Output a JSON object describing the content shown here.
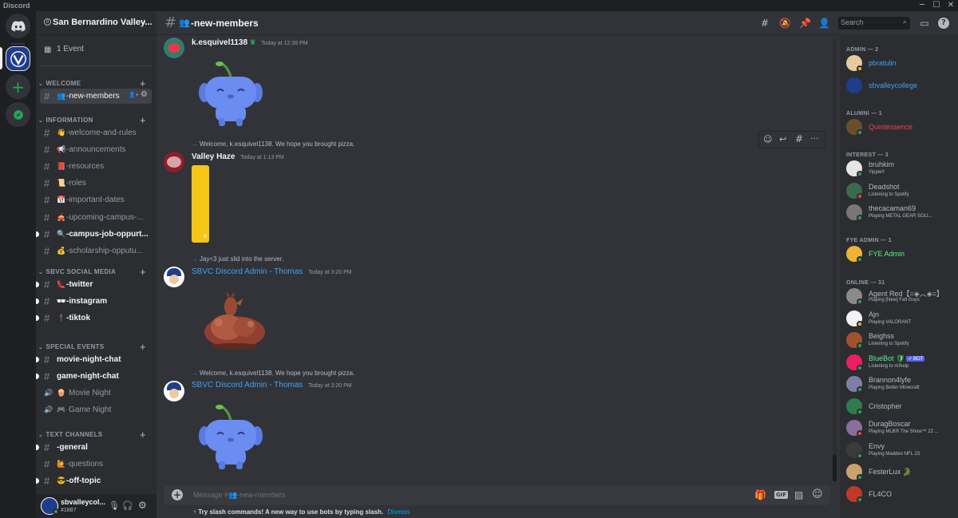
{
  "window": {
    "title": "Discord"
  },
  "guild_rail": {
    "items": [
      "discord-home",
      "sbvc-server",
      "add-server",
      "explore"
    ]
  },
  "server": {
    "name": "San Bernardino Valley...",
    "events_label": "1 Event",
    "categories": [
      {
        "label": "WELCOME",
        "channels": [
          {
            "emoji": "👥",
            "name": "-new-members",
            "state": "active"
          }
        ]
      },
      {
        "label": "INFORMATION",
        "channels": [
          {
            "emoji": "👋",
            "name": "-welcome-and-rules",
            "state": "normal"
          },
          {
            "emoji": "📢",
            "name": "-announcements",
            "state": "normal"
          },
          {
            "emoji": "📕",
            "name": "-resources",
            "state": "normal"
          },
          {
            "emoji": "📜",
            "name": "-roles",
            "state": "normal"
          },
          {
            "emoji": "📅",
            "name": "-important-dates",
            "state": "normal"
          },
          {
            "emoji": "🎪",
            "name": "-upcoming-campus-...",
            "state": "normal"
          },
          {
            "emoji": "🔍",
            "name": "-campus-job-oppurt...",
            "state": "unread"
          },
          {
            "emoji": "💰",
            "name": "-scholarship-opputu...",
            "state": "normal"
          }
        ]
      },
      {
        "label": "SBVC SOCIAL MEDIA",
        "channels": [
          {
            "emoji": "👠",
            "name": "-twitter",
            "state": "unread"
          },
          {
            "emoji": "🕶",
            "name": "-instagram",
            "state": "unread"
          },
          {
            "emoji": "🕴",
            "name": "-tiktok",
            "state": "unread"
          }
        ]
      },
      {
        "label": "SPECIAL EVENTS",
        "channels": [
          {
            "emoji": "",
            "name": "movie-night-chat",
            "state": "unread"
          },
          {
            "emoji": "",
            "name": "game-night-chat",
            "state": "unread"
          },
          {
            "emoji": "🍿",
            "name": "Movie Night",
            "state": "voice"
          },
          {
            "emoji": "🎮",
            "name": "Game Night",
            "state": "voice"
          }
        ]
      },
      {
        "label": "TEXT CHANNELS",
        "channels": [
          {
            "emoji": "",
            "name": "-general",
            "state": "unread"
          },
          {
            "emoji": "🙋",
            "name": "-questions",
            "state": "normal"
          },
          {
            "emoji": "😎",
            "name": "-off-topic",
            "state": "unread"
          }
        ]
      }
    ]
  },
  "user_panel": {
    "username": "sbvalleycol...",
    "tag": "#1887"
  },
  "channel_header": {
    "name": "-new-members",
    "search_placeholder": "Search"
  },
  "messages": [
    {
      "type": "message",
      "author": "k.esquivel1138",
      "author_color": "#f2f3f5",
      "time": "Today at 12:39 PM",
      "attachment": "wumpus-sticker"
    },
    {
      "type": "reply",
      "system_text": "Welcome, k.esquivel1138. We hope you brought pizza.",
      "author": "Valley Haze",
      "author_color": "#f2f3f5",
      "time": "Today at 1:13 PM",
      "attachment": "yellow-image"
    },
    {
      "type": "reply",
      "system_text": "Jay<3 just slid into the server.",
      "author": "SBVC Discord Admin - Thomas",
      "author_color": "#3fa2f5",
      "time": "Today at 3:20 PM",
      "attachment": "chicken-sticker"
    },
    {
      "type": "reply",
      "system_text": "Welcome, k.esquivel1138. We hope you brought pizza.",
      "author": "SBVC Discord Admin - Thomas",
      "author_color": "#3fa2f5",
      "time": "Today at 3:20 PM",
      "attachment": "wumpus-sticker"
    }
  ],
  "composer": {
    "placeholder": "Message #👥-new-members",
    "tip": "Try slash commands! A new way to use bots by typing slash.",
    "dismiss": "Dismiss"
  },
  "member_list": [
    {
      "group": "ADMIN — 2",
      "members": [
        {
          "name": "pbratulin",
          "status_text": "",
          "name_color": "#3fa2f5",
          "avatar_color": "#e8c9a0",
          "presence": "idle"
        },
        {
          "name": "sbvalleycollege",
          "status_text": "",
          "name_color": "#3fa2f5",
          "avatar_color": "#1f3d8a",
          "presence": "none"
        }
      ]
    },
    {
      "group": "ALUMNI — 1",
      "members": [
        {
          "name": "Quintessence",
          "status_text": "",
          "name_color": "#ed4245",
          "avatar_color": "#6b4f2a",
          "presence": "online"
        }
      ]
    },
    {
      "group": "INTEREST — 3",
      "members": [
        {
          "name": "bruhkim",
          "status_text": "Yippie!!",
          "name_color": "#b5bac1",
          "avatar_color": "#e6e6e6",
          "presence": "online"
        },
        {
          "name": "Deadshot",
          "status_text": "Listening to Spotify",
          "name_color": "#b5bac1",
          "avatar_color": "#3a6b4f",
          "presence": "dnd"
        },
        {
          "name": "thecacaman69",
          "status_text": "Playing METAL GEAR SOLI...",
          "name_color": "#b5bac1",
          "avatar_color": "#777777",
          "presence": "online"
        }
      ]
    },
    {
      "group": "FYE ADMIN — 1",
      "members": [
        {
          "name": "FYE Admin",
          "status_text": "",
          "name_color": "#57f287",
          "avatar_color": "#f0b232",
          "presence": "online"
        }
      ]
    },
    {
      "group": "ONLINE — 31",
      "members": [
        {
          "name": "Agent Red【=◈︿◈=】",
          "status_text": "Playing [New] Fall Guys",
          "name_color": "#b5bac1",
          "avatar_color": "#8a8a8a",
          "presence": "online"
        },
        {
          "name": "Ajn",
          "status_text": "Playing VALORANT",
          "name_color": "#b5bac1",
          "avatar_color": "#f2f2f2",
          "presence": "idle"
        },
        {
          "name": "Beighss",
          "status_text": "Listening to Spotify",
          "name_color": "#b5bac1",
          "avatar_color": "#a0522d",
          "presence": "online"
        },
        {
          "name": "BlueBot 🛡",
          "status_text": "Listening to m!help",
          "name_color": "#57f287",
          "avatar_color": "#e91e63",
          "presence": "online",
          "badge": "✓ BOT"
        },
        {
          "name": "Brannon4lyfe",
          "status_text": "Playing Better Minecraft",
          "name_color": "#b5bac1",
          "avatar_color": "#7e7ea8",
          "presence": "online"
        },
        {
          "name": "Cristopher",
          "status_text": "",
          "name_color": "#b5bac1",
          "avatar_color": "#2e7d4f",
          "presence": "online"
        },
        {
          "name": "DuragBoscar",
          "status_text": "Playing MLB® The Show™ 22 ...",
          "name_color": "#b5bac1",
          "avatar_color": "#8a6f9e",
          "presence": "dnd"
        },
        {
          "name": "Envy",
          "status_text": "Playing Madden NFL 23",
          "name_color": "#b5bac1",
          "avatar_color": "#3b3b3b",
          "presence": "online"
        },
        {
          "name": "FesterLux 🐊",
          "status_text": "",
          "name_color": "#b5bac1",
          "avatar_color": "#c9a36b",
          "presence": "online"
        },
        {
          "name": "FL4CO",
          "status_text": "",
          "name_color": "#b5bac1",
          "avatar_color": "#c0392b",
          "presence": "online"
        }
      ]
    }
  ]
}
